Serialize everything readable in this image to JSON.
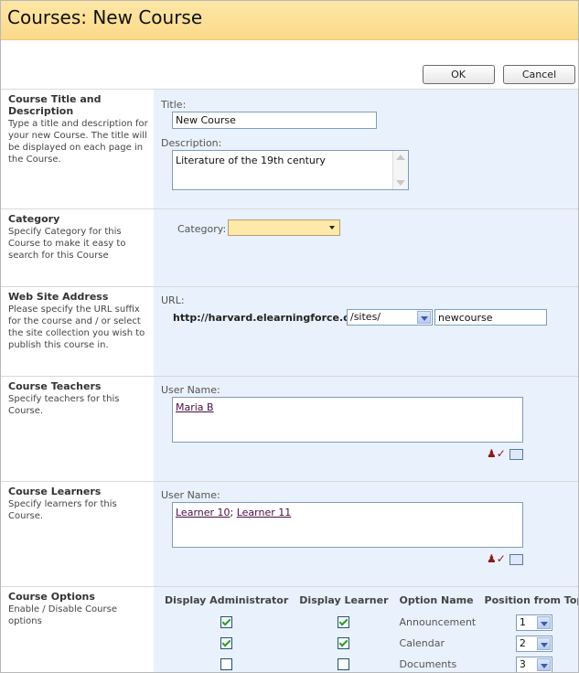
{
  "header": {
    "title": "Courses: New Course"
  },
  "buttons": {
    "ok": "OK",
    "cancel": "Cancel"
  },
  "sections": {
    "title_desc": {
      "title": "Course Title and Description",
      "desc": "Type a title and description for your new Course. The title will be displayed on each page in the Course.",
      "title_label": "Title:",
      "title_value": "New Course",
      "desc_label": "Description:",
      "desc_value": "Literature of the 19th century"
    },
    "category": {
      "title": "Category",
      "desc": "Specify Category for this Course to make it easy to search for this Course",
      "label": "Category:",
      "value": ""
    },
    "website": {
      "title": "Web Site Address",
      "desc": "Please specify the URL suffix for the course and / or select the site collection you wish to publish this course in.",
      "label": "URL:",
      "base": "http://harvard.elearningforce.org",
      "path_selected": "/sites/",
      "suffix": "newcourse"
    },
    "teachers": {
      "title": "Course Teachers",
      "desc": "Specify teachers for this Course.",
      "label": "User Name:",
      "users": [
        "Maria B"
      ]
    },
    "learners": {
      "title": "Course Learners",
      "desc": "Specify learners for this Course.",
      "label": "User Name:",
      "users": [
        "Learner 10",
        "Learner 11"
      ],
      "separator": "; "
    },
    "options": {
      "title": "Course Options",
      "desc": "Enable / Disable Course options",
      "headers": [
        "Display Administrator",
        "Display Learner",
        "Option Name",
        "Position from Top"
      ],
      "rows": [
        {
          "admin": true,
          "learner": true,
          "name": "Announcement",
          "position": "1"
        },
        {
          "admin": true,
          "learner": true,
          "name": "Calendar",
          "position": "2"
        },
        {
          "admin": false,
          "learner": false,
          "name": "Documents",
          "position": "3"
        }
      ]
    }
  },
  "icons": {
    "check_names": "check-names-icon",
    "browse": "address-book-icon"
  },
  "colors": {
    "header_bg": "#fbd98a",
    "panel_bg": "#e9f1fc",
    "category_bg": "#ffe9a8"
  }
}
